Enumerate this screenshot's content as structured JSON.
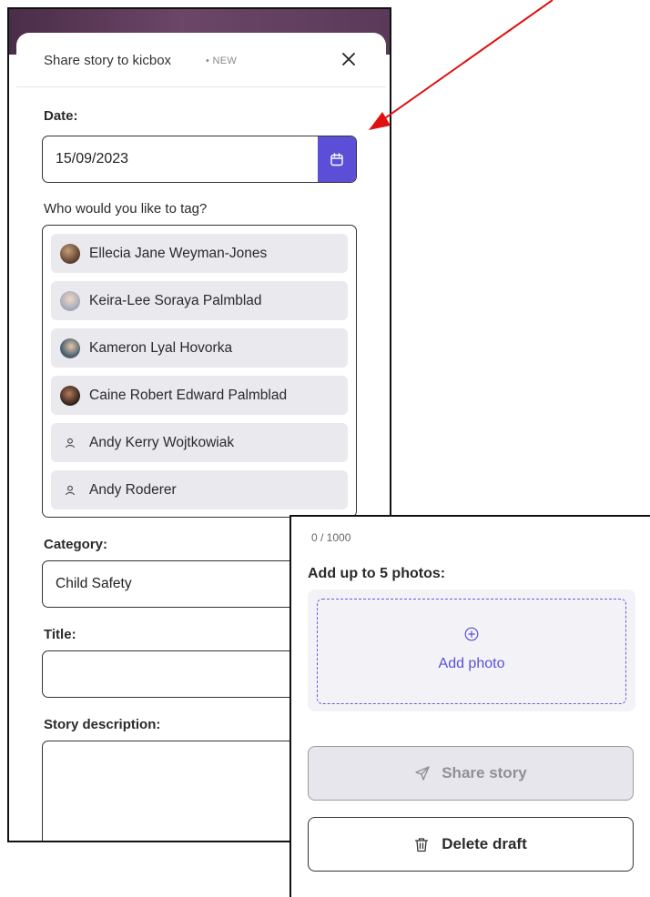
{
  "modal": {
    "title": "Share story to kicbox",
    "badge": "• NEW",
    "close_icon": "close-icon"
  },
  "date": {
    "label": "Date:",
    "value": "15/09/2023",
    "button_icon": "calendar-icon"
  },
  "tagging": {
    "label": "Who would you like to tag?",
    "people": [
      {
        "name": "Ellecia Jane Weyman-Jones",
        "avatar": "photo"
      },
      {
        "name": "Keira-Lee Soraya Palmblad",
        "avatar": "photo"
      },
      {
        "name": "Kameron Lyal Hovorka",
        "avatar": "photo"
      },
      {
        "name": "Caine Robert Edward Palmblad",
        "avatar": "photo"
      },
      {
        "name": "Andy Kerry Wojtkowiak",
        "avatar": "person-icon"
      },
      {
        "name": "Andy Roderer",
        "avatar": "person-icon"
      }
    ]
  },
  "category": {
    "label": "Category:",
    "value": "Child Safety"
  },
  "title_field": {
    "label": "Title:",
    "value": ""
  },
  "description": {
    "label": "Story description:",
    "value": "",
    "char_count": "0 / 1000"
  },
  "photos": {
    "label": "Add up to 5 photos:",
    "add_label": "Add photo",
    "add_icon": "plus-circle-icon"
  },
  "actions": {
    "share_label": "Share story",
    "share_icon": "send-icon",
    "delete_label": "Delete draft",
    "delete_icon": "trash-icon"
  },
  "colors": {
    "accent": "#5b4fd8",
    "annotation": "#e01010",
    "tag_bg": "#e9e9ee",
    "disabled_bg": "#e6e6ec"
  }
}
